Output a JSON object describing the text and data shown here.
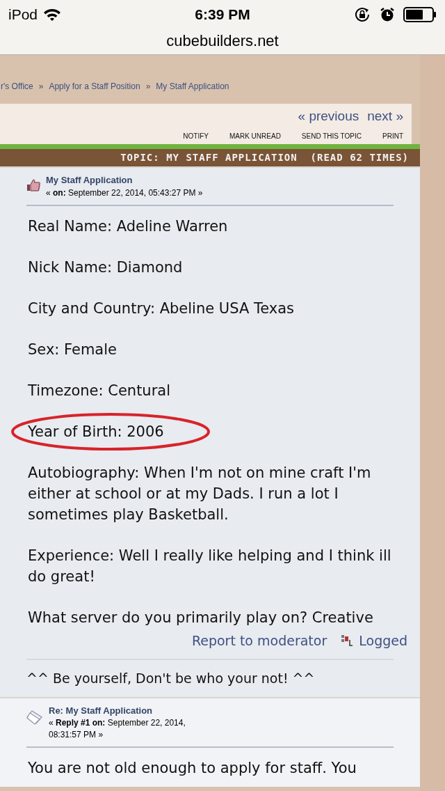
{
  "status_bar": {
    "carrier": "iPod",
    "time": "6:39 PM"
  },
  "url": "cubebuilders.net",
  "breadcrumb": [
    {
      "kind": "link",
      "text": "r's Office"
    },
    {
      "kind": "separator",
      "text": "»"
    },
    {
      "kind": "link",
      "text": "Apply for a Staff Position"
    },
    {
      "kind": "separator",
      "text": "»"
    },
    {
      "kind": "link",
      "text": "My Staff Application"
    }
  ],
  "topic_nav": {
    "previous": "« previous",
    "next": "next »",
    "actions": [
      "NOTIFY",
      "MARK UNREAD",
      "SEND THIS TOPIC",
      "PRINT"
    ]
  },
  "topic_header": "TOPIC: MY STAFF APPLICATION  (READ 62 TIMES)",
  "posts": [
    {
      "kind": "thumb",
      "title": "My Staff Application",
      "meta": "« **on:** September 22, 2014, 05:43:27 PM »",
      "paragraphs": [
        {
          "text": "Real Name: Adeline Warren",
          "circled": false
        },
        {
          "text": "Nick Name: Diamond",
          "circled": false
        },
        {
          "text": "City and Country: Abeline USA Texas",
          "circled": false
        },
        {
          "text": "Sex: Female",
          "circled": false
        },
        {
          "text": "Timezone: Centural",
          "circled": false
        },
        {
          "text": "Year of Birth: 2006",
          "circled": true
        },
        {
          "text": "Autobiography: When I'm not on mine craft I'm either at school or at my Dads. I run a lot I sometimes play Basketball.",
          "circled": false
        },
        {
          "text": "Experience: Well I really like helping and I think ill do great!",
          "circled": false
        },
        {
          "text": "What server do you primarily play on? Creative",
          "circled": false
        }
      ],
      "report": "Report to moderator",
      "logged": "Logged",
      "signature": "^^ Be yourself, Don't be who your not! ^^"
    },
    {
      "kind": "papers",
      "title": "Re: My Staff Application",
      "meta": "« **Reply #1 on:** September 22, 2014, 08:31:57 PM »",
      "paragraphs": [
        {
          "text": "You are not old enough to apply for staff.  You",
          "circled": false
        }
      ]
    }
  ]
}
